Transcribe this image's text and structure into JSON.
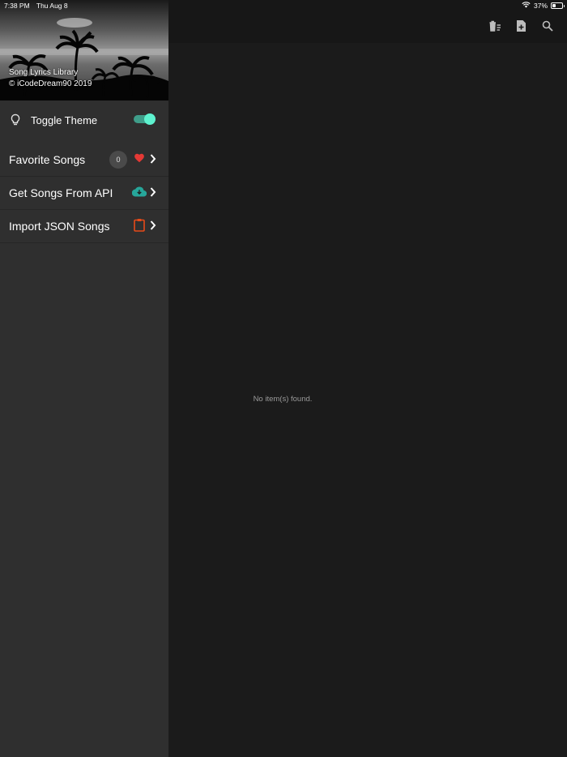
{
  "status_bar": {
    "time": "7:38 PM",
    "date": "Thu Aug 8",
    "battery_text": "37%",
    "battery_level": 0.37,
    "icons": [
      "wifi-icon",
      "battery-icon"
    ]
  },
  "drawer": {
    "header": {
      "title": "Song Lyrics Library",
      "copyright": "© iCodeDream90 2019"
    },
    "theme_toggle": {
      "label": "Toggle Theme",
      "icon": "lightbulb-icon",
      "checked": true
    },
    "items": [
      {
        "label": "Favorite Songs",
        "badge": "0",
        "icon": "heart-icon",
        "icon_color": "#e53935"
      },
      {
        "label": "Get Songs From API",
        "icon": "cloud-download-icon",
        "icon_color": "#26a69a"
      },
      {
        "label": "Import JSON Songs",
        "icon": "clipboard-icon",
        "icon_color": "#e64a19"
      }
    ]
  },
  "toolbar": {
    "actions": [
      "delete-all-icon",
      "add-file-icon",
      "search-icon"
    ]
  },
  "main": {
    "empty_message": "No item(s) found."
  },
  "colors": {
    "accent": "#5ef2cf",
    "drawer_bg": "#2f2f2f",
    "main_bg": "#1b1b1b"
  }
}
